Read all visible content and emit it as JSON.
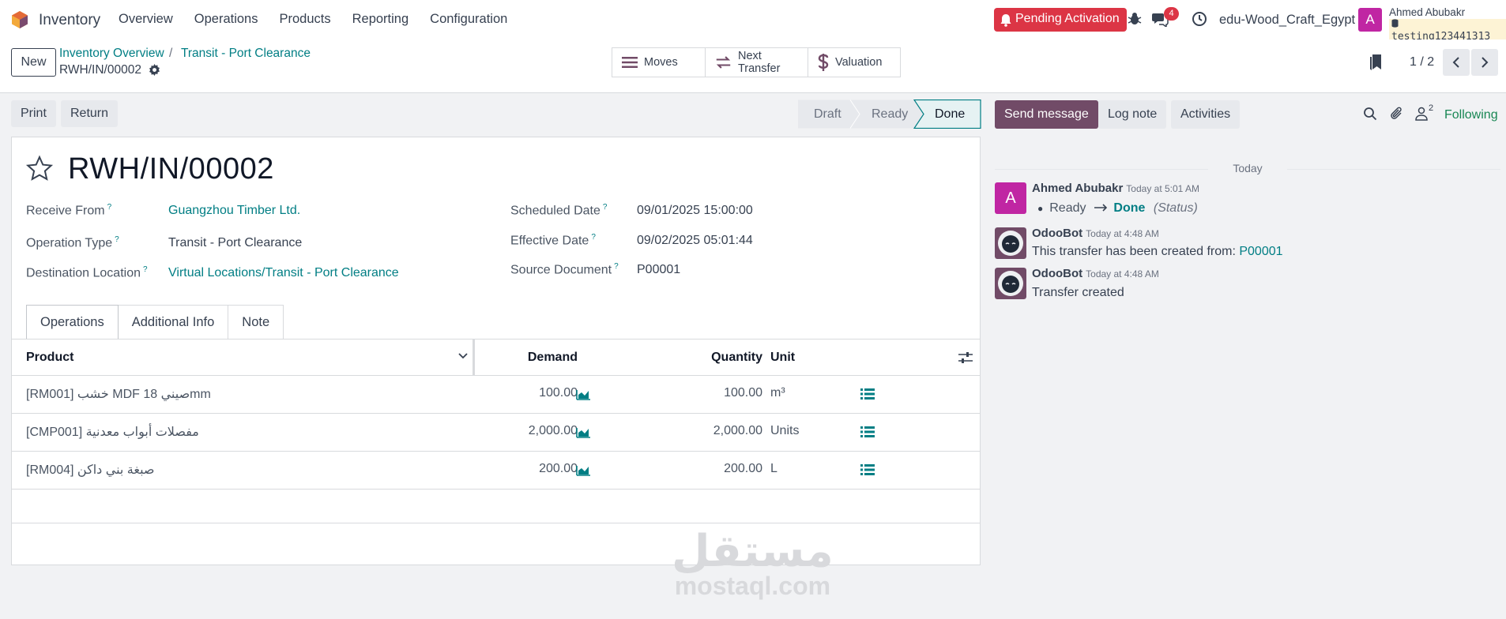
{
  "navbar": {
    "app_name": "Inventory",
    "menu": [
      "Overview",
      "Operations",
      "Products",
      "Reporting",
      "Configuration"
    ],
    "pending_label": "Pending Activation",
    "message_count": "4",
    "company": "edu-Wood_Craft_Egypt",
    "user_initial": "A",
    "user_name": "Ahmed Abubakr",
    "user_db": "testing123441313"
  },
  "control": {
    "new_label": "New",
    "breadcrumb_1": "Inventory Overview",
    "breadcrumb_sep": "/",
    "breadcrumb_2": "Transit - Port Clearance",
    "record_ref": "RWH/IN/00002",
    "smart_buttons": [
      "Moves",
      "Next Transfer",
      "Valuation"
    ],
    "pager": "1 / 2"
  },
  "actions": {
    "print_label": "Print",
    "return_label": "Return",
    "stages": [
      "Draft",
      "Ready",
      "Done"
    ],
    "active_stage": "Done"
  },
  "form": {
    "title": "RWH/IN/00002",
    "receive_from_label": "Receive From",
    "receive_from": "Guangzhou Timber Ltd.",
    "operation_type_label": "Operation Type",
    "operation_type": "Transit - Port Clearance",
    "destination_label": "Destination Location",
    "destination": "Virtual Locations/Transit - Port Clearance",
    "scheduled_date_label": "Scheduled Date",
    "scheduled_date": "09/01/2025 15:00:00",
    "effective_date_label": "Effective Date",
    "effective_date": "09/02/2025 05:01:44",
    "source_document_label": "Source Document",
    "source_document": "P00001",
    "help_mark": "?",
    "tabs": [
      "Operations",
      "Additional Info",
      "Note"
    ]
  },
  "table": {
    "headers": {
      "product": "Product",
      "demand": "Demand",
      "quantity": "Quantity",
      "unit": "Unit"
    },
    "rows": [
      {
        "product": "[RM001] خشب MDF 18 صينيmm",
        "demand": "100.00",
        "quantity": "100.00",
        "unit": "m³"
      },
      {
        "product": "[CMP001] مفصلات أبواب معدنية",
        "demand": "2,000.00",
        "quantity": "2,000.00",
        "unit": "Units"
      },
      {
        "product": "[RM004] صبغة بني داكن",
        "demand": "200.00",
        "quantity": "200.00",
        "unit": "L"
      }
    ]
  },
  "chatter": {
    "send_message": "Send message",
    "log_note": "Log note",
    "activities": "Activities",
    "follower_count": "2",
    "following": "Following",
    "today": "Today",
    "messages": [
      {
        "author": "Ahmed Abubakr",
        "time": "Today at 5:01 AM",
        "from": "Ready",
        "to": "Done",
        "field": "(Status)"
      },
      {
        "author": "OdooBot",
        "time": "Today at 4:48 AM",
        "text": "This transfer has been created from:",
        "link": "P00001"
      },
      {
        "author": "OdooBot",
        "time": "Today at 4:48 AM",
        "text": "Transfer created"
      }
    ]
  },
  "watermark": {
    "arabic": "مستقل",
    "latin": "mostaql.com"
  }
}
